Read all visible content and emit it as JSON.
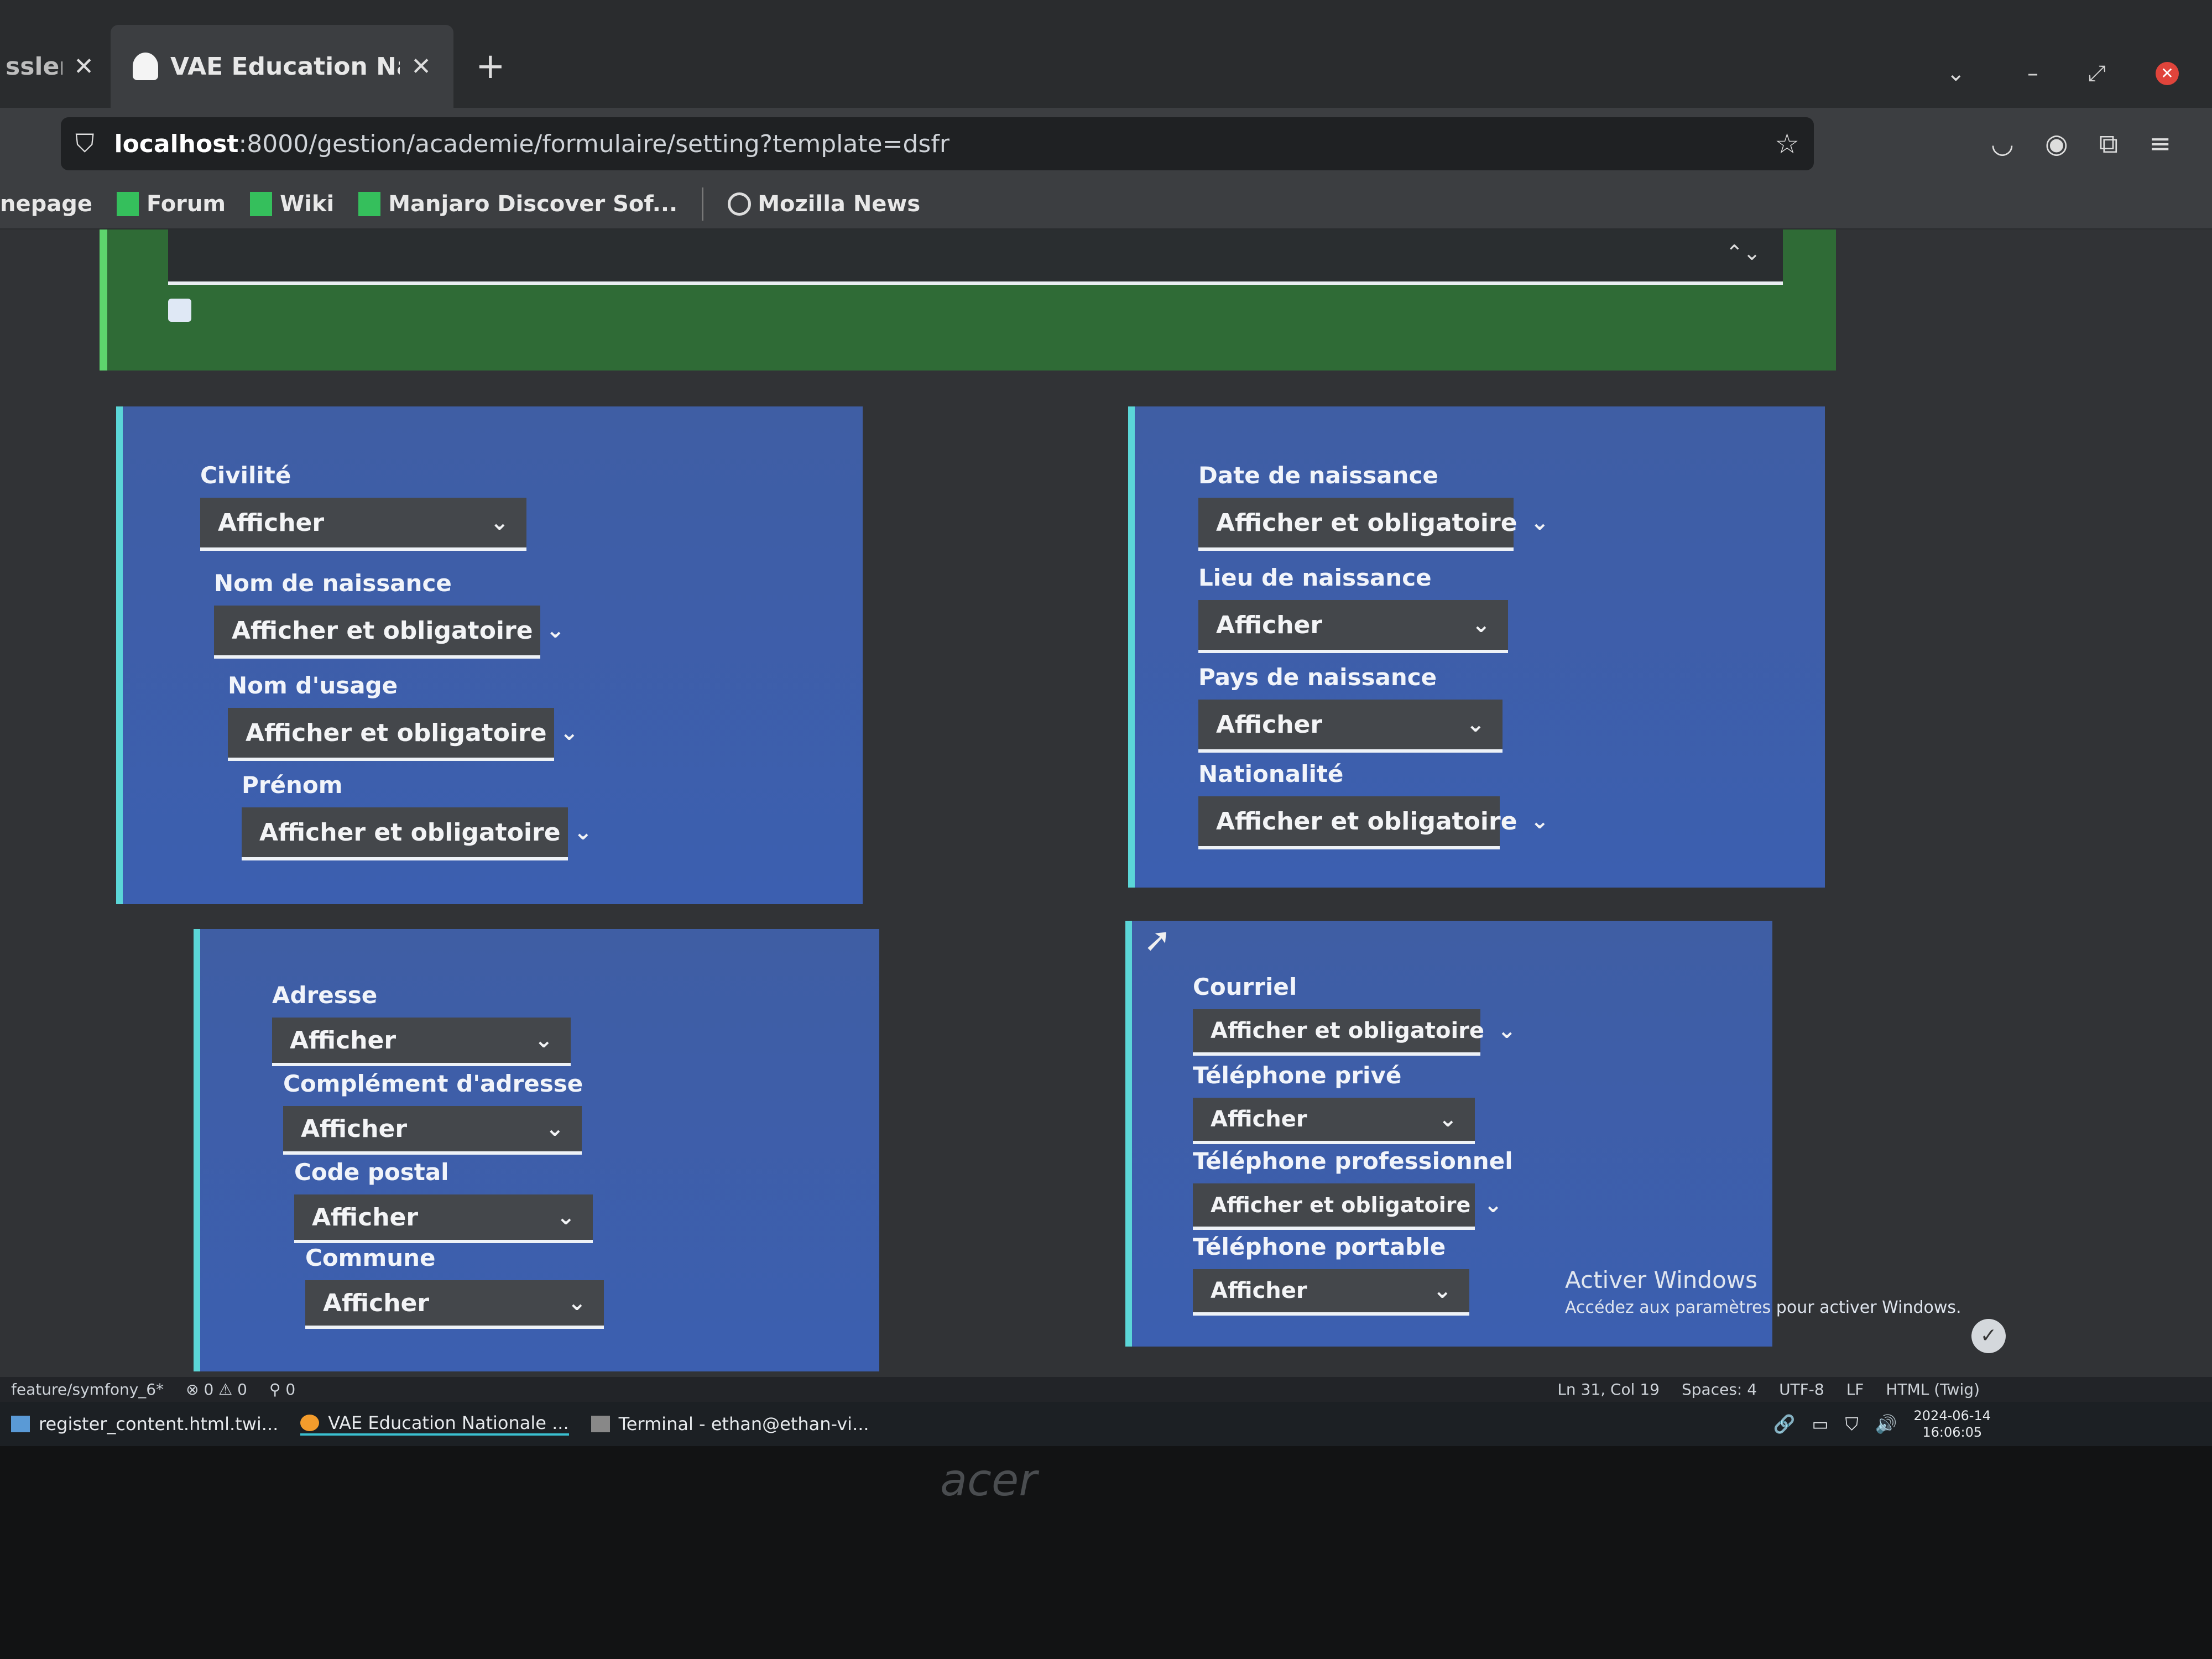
{
  "browser": {
    "tabs": [
      {
        "title": "ssler [/",
        "active": false
      },
      {
        "title": "VAE Education Nationale",
        "active": true
      }
    ],
    "new_tab": "+",
    "url_host": "localhost",
    "url_rest": ":8000/gestion/academie/formulaire/setting?template=dsfr",
    "bookmarks": [
      "nepage",
      "Forum",
      "Wiki",
      "Manjaro Discover Sof...",
      "Mozilla News"
    ]
  },
  "form": {
    "card_identity": [
      {
        "label": "Civilité",
        "value": "Afficher"
      },
      {
        "label": "Nom de naissance",
        "value": "Afficher et obligatoire"
      },
      {
        "label": "Nom d'usage",
        "value": "Afficher et obligatoire"
      },
      {
        "label": "Prénom",
        "value": "Afficher et obligatoire"
      }
    ],
    "card_birth": [
      {
        "label": "Date de naissance",
        "value": "Afficher et obligatoire"
      },
      {
        "label": "Lieu de naissance",
        "value": "Afficher"
      },
      {
        "label": "Pays de naissance",
        "value": "Afficher"
      },
      {
        "label": "Nationalité",
        "value": "Afficher et obligatoire"
      }
    ],
    "card_address": [
      {
        "label": "Adresse",
        "value": "Afficher"
      },
      {
        "label": "Complément d'adresse",
        "value": "Afficher"
      },
      {
        "label": "Code postal",
        "value": "Afficher"
      },
      {
        "label": "Commune",
        "value": "Afficher"
      }
    ],
    "card_contact": [
      {
        "label": "Courriel",
        "value": "Afficher et obligatoire"
      },
      {
        "label": "Téléphone privé",
        "value": "Afficher"
      },
      {
        "label": "Téléphone professionnel",
        "value": "Afficher et obligatoire"
      },
      {
        "label": "Téléphone portable",
        "value": "Afficher"
      }
    ]
  },
  "watermark": {
    "title": "Activer Windows",
    "subtitle": "Accédez aux paramètres pour activer Windows."
  },
  "editor_status": {
    "branch": "feature/symfony_6*",
    "problems": "⊗ 0 ⚠ 0",
    "ports": "⚲ 0",
    "position": "Ln 31, Col 19",
    "spaces": "Spaces: 4",
    "encoding": "UTF-8",
    "eol": "LF",
    "language": "HTML (Twig)"
  },
  "taskbar": {
    "items": [
      "register_content.html.twi...",
      "VAE Education Nationale ...",
      "Terminal - ethan@ethan-vi..."
    ],
    "date": "2024-06-14",
    "time": "16:06:05"
  },
  "monitor_brand": "acer"
}
